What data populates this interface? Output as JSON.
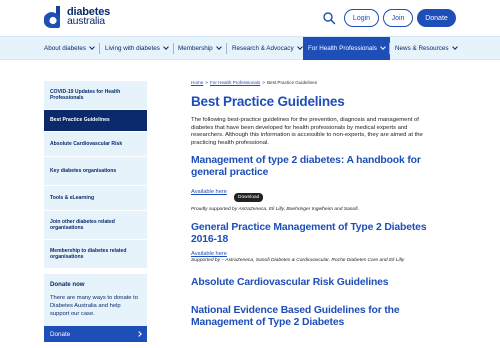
{
  "header": {
    "logo_line1": "diabetes",
    "logo_line2": "australia",
    "login_label": "Login",
    "join_label": "Join",
    "donate_label": "Donate",
    "brand_color": "#1e4eb8",
    "navy_color": "#0a2a6b",
    "light_bg": "#e6f3fb"
  },
  "nav": {
    "items": [
      {
        "label": "About diabetes",
        "active": false
      },
      {
        "label": "Living with diabetes",
        "active": false
      },
      {
        "label": "Membership",
        "active": false
      },
      {
        "label": "Research & Advocacy",
        "active": false
      },
      {
        "label": "For Health Professionals",
        "active": true
      },
      {
        "label": "News & Resources",
        "active": false
      }
    ]
  },
  "sidebar": {
    "items": [
      {
        "label": "COVID-19 Updates for Health Professionals",
        "active": false
      },
      {
        "label": "Best Practice Guidelines",
        "active": true
      },
      {
        "label": "Absolute Cardiovascular Risk",
        "active": false
      },
      {
        "label": "Key diabetes organisations",
        "active": false
      },
      {
        "label": "Tools & eLearning",
        "active": false
      },
      {
        "label": "Join other diabetes related organisations",
        "active": false
      },
      {
        "label": "Membership to diabetes related organisations",
        "active": false
      }
    ],
    "donate": {
      "title": "Donate now",
      "text": "There are many ways to donate to Diabetes Australia and help support our case.",
      "button_label": "Donate"
    }
  },
  "main": {
    "breadcrumb": {
      "home": "Home",
      "section": "For Health Professionals",
      "current": "Best Practice Guidelines",
      "separator": ">"
    },
    "title": "Best Practice Guidelines",
    "intro": "The following best-practice guidelines for the prevention, diagnosis and management of diabetes that have been developed for health professionals by medical experts and researchers. Although this information is accessible to non-experts, they are aimed at the practicing health professional.",
    "guidelines": [
      {
        "title": "Management of type 2 diabetes: A handbook for general practice",
        "link": "Available here",
        "support": "Proudly supported by AstraZeneca, Eli Lilly, Boehringer Ingelheim and Sanofi."
      },
      {
        "title": "General Practice Management of Type 2 Diabetes 2016-18",
        "link": "Available here",
        "support": "Supported by – AstraZeneca, Sanofi Diabetes & Cardiovascular, Roche Diabetes Care and Eli Lilly"
      },
      {
        "title": "Absolute Cardiovascular Risk Guidelines",
        "link": "",
        "support": ""
      },
      {
        "title": "National Evidence Based Guidelines for the Management of Type 2 Diabetes",
        "link": "",
        "support": ""
      }
    ],
    "download_tooltip": "Download"
  }
}
